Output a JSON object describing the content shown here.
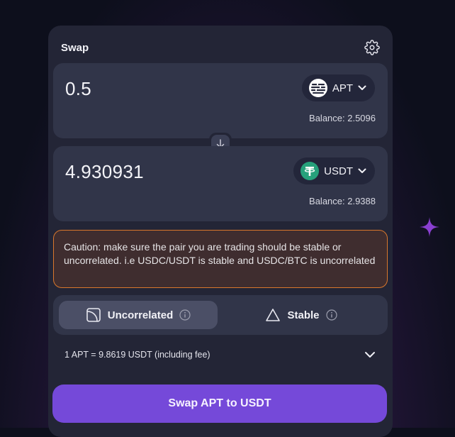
{
  "swap": {
    "title": "Swap",
    "settings_icon": "gear-icon"
  },
  "from": {
    "amount": "0.5",
    "token": "APT",
    "token_icon": "aptos-logo-icon",
    "balance": "Balance: 2.5096"
  },
  "to": {
    "amount": "4.930931",
    "token": "USDT",
    "token_icon": "tether-logo-icon",
    "token_color": "#26a17b",
    "balance": "Balance: 2.9388"
  },
  "switch_icon": "arrow-down-icon",
  "caution": "Caution: make sure the pair you are trading should be stable or uncorrelated. i.e USDC/USDT is stable and USDC/BTC is uncorrelated",
  "modes": {
    "uncorrelated": {
      "label": "Uncorrelated",
      "icon": "curve-icon",
      "selected": true
    },
    "stable": {
      "label": "Stable",
      "icon": "triangle-icon",
      "selected": false
    }
  },
  "rate": "1 APT = 9.8619 USDT (including fee)",
  "action": {
    "label": "Swap APT to USDT"
  },
  "colors": {
    "accent": "#7549d9",
    "caution_border": "#d9772c",
    "card": "#232536",
    "panel": "#313549"
  }
}
